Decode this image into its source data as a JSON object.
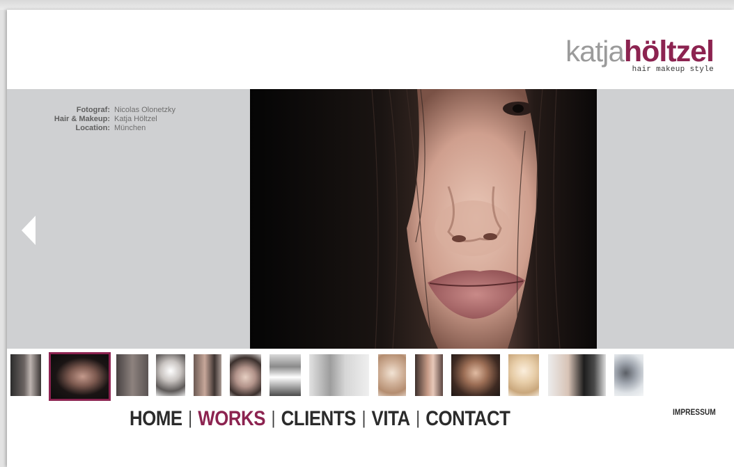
{
  "logo": {
    "first": "katja",
    "last": "höltzel",
    "tagline": "hair makeup style"
  },
  "credits": [
    {
      "label": "Fotograf:",
      "value": "Nicolas Olonetzky"
    },
    {
      "label": "Hair & Makeup:",
      "value": "Katja Höltzel"
    },
    {
      "label": "Location:",
      "value": "München"
    }
  ],
  "colors": {
    "accent": "#8c2350",
    "band": "#cfd0d2",
    "nav_text": "#2b2b2b"
  },
  "nav": {
    "items": [
      "HOME",
      "WORKS",
      "CLIENTS",
      "VITA",
      "CONTACT"
    ],
    "separator": "|",
    "active": "WORKS"
  },
  "footer": {
    "impressum": "IMPRESSUM"
  },
  "icons": {
    "prev": "left-arrow-icon"
  }
}
